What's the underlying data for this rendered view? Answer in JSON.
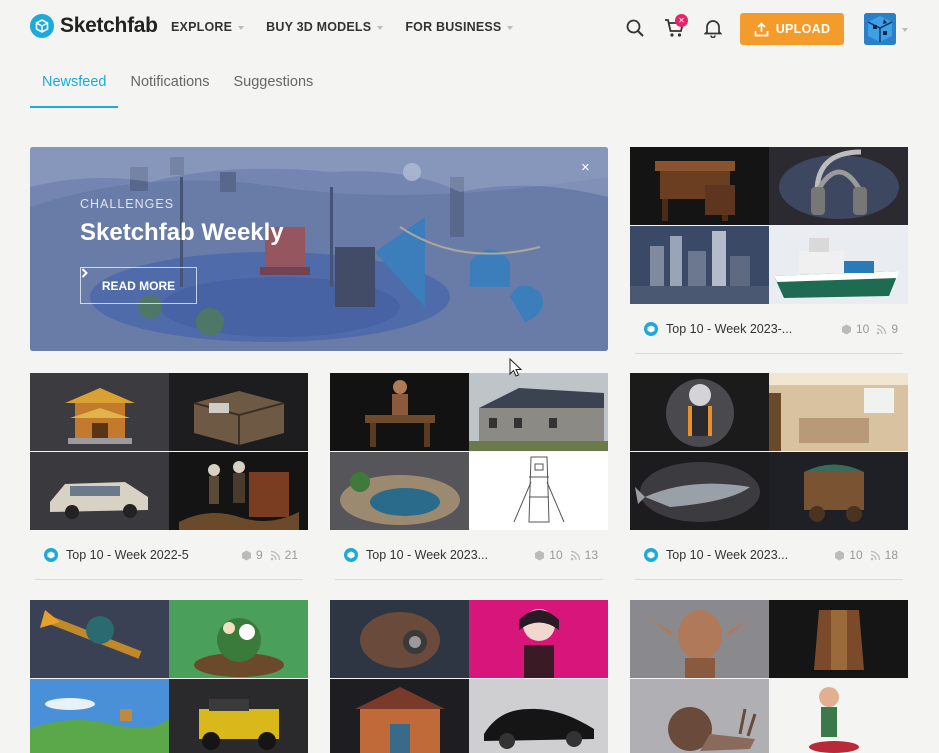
{
  "brand": {
    "name": "Sketchfab"
  },
  "nav": [
    {
      "label": "EXPLORE"
    },
    {
      "label": "BUY 3D MODELS"
    },
    {
      "label": "FOR BUSINESS"
    }
  ],
  "header": {
    "upload_label": "UPLOAD",
    "icons": [
      "search-icon",
      "cart-icon",
      "bell-icon",
      "upload-icon",
      "avatar"
    ],
    "cart_badge": "✕"
  },
  "tabs": [
    {
      "label": "Newsfeed",
      "active": true
    },
    {
      "label": "Notifications",
      "active": false
    },
    {
      "label": "Suggestions",
      "active": false
    }
  ],
  "banner": {
    "kicker": "CHALLENGES",
    "title": "Sketchfab Weekly",
    "button_label": "READ MORE",
    "button_icon": "chevron-right-icon",
    "close_label": "×"
  },
  "cards": [
    {
      "title": "Top 10 - Week 2023-...",
      "models": "10",
      "follows": "9"
    },
    {
      "title": "Top 10 - Week 2022-5",
      "models": "9",
      "follows": "21"
    },
    {
      "title": "Top 10 - Week 2023...",
      "models": "10",
      "follows": "13"
    },
    {
      "title": "Top 10 - Week 2023...",
      "models": "10",
      "follows": "18"
    }
  ],
  "colors": {
    "accent": "#1caad9",
    "upload": "#f39c2b",
    "badge": "#e3256b",
    "background": "#f4f4f3"
  }
}
